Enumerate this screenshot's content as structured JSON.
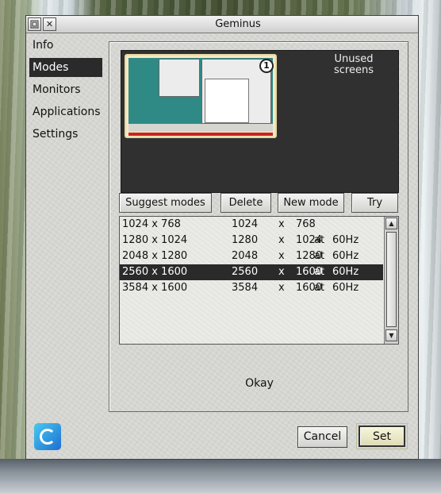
{
  "window": {
    "title": "Geminus"
  },
  "titlebar": {
    "back_icon": "window-back-icon",
    "close_glyph": "✕"
  },
  "sidebar": {
    "items": [
      {
        "label": "Info",
        "selected": false
      },
      {
        "label": "Modes",
        "selected": true
      },
      {
        "label": "Monitors",
        "selected": false
      },
      {
        "label": "Applications",
        "selected": false
      },
      {
        "label": "Settings",
        "selected": false
      }
    ]
  },
  "screens": {
    "badge": "1",
    "unused_label": "Unused screens"
  },
  "actions": {
    "suggest": "Suggest modes",
    "delete": "Delete",
    "new_mode": "New mode",
    "try": "Try"
  },
  "modes": {
    "rows": [
      {
        "name": "1024 x 768",
        "w": "1024",
        "x": "x",
        "h": "768",
        "at": "",
        "hz": "",
        "selected": false
      },
      {
        "name": "1280 x 1024",
        "w": "1280",
        "x": "x",
        "h": "1024",
        "at": "at",
        "hz": "60Hz",
        "selected": false
      },
      {
        "name": "2048 x 1280",
        "w": "2048",
        "x": "x",
        "h": "1280",
        "at": "at",
        "hz": "60Hz",
        "selected": false
      },
      {
        "name": "2560 x 1600",
        "w": "2560",
        "x": "x",
        "h": "1600",
        "at": "at",
        "hz": "60Hz",
        "selected": true
      },
      {
        "name": "3584 x 1600",
        "w": "3584",
        "x": "x",
        "h": "1600",
        "at": "at",
        "hz": "60Hz",
        "selected": false
      }
    ]
  },
  "status": {
    "text": "Okay"
  },
  "footer": {
    "cancel": "Cancel",
    "set": "Set"
  },
  "colors": {
    "selection": "#2a2a2a",
    "desktop": "#2f8a86",
    "screens_bg": "#303030"
  }
}
